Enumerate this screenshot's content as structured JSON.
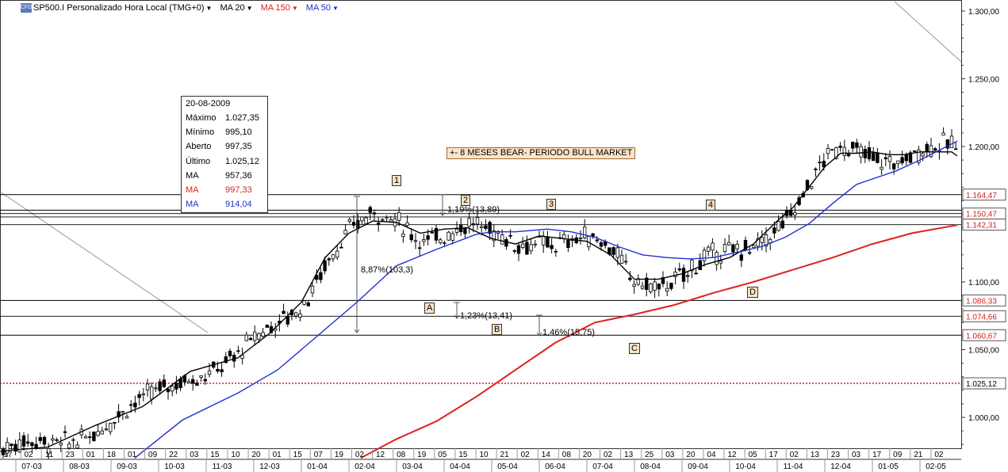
{
  "toolbar": {
    "symbol": "SP500.I Personalizado Hora Local (TMG+0)",
    "ma20": "MA 20",
    "ma150": "MA 150",
    "ma50": "MA 50",
    "logo": "CFD"
  },
  "colors": {
    "ma20": "#000000",
    "ma50": "#1f2fd6",
    "ma150": "#e02020",
    "price_label": "#e02020",
    "banner_bg": "#ffe3c8"
  },
  "info": {
    "date": "20-08-2009",
    "rows": [
      {
        "k": "Máximo",
        "v": "1.027,35",
        "color": "#000000"
      },
      {
        "k": "Mínimo",
        "v": "995,10",
        "color": "#000000"
      },
      {
        "k": "Aberto",
        "v": "997,35",
        "color": "#000000"
      },
      {
        "k": "Último",
        "v": "1.025,12",
        "color": "#000000"
      },
      {
        "k": "MA",
        "v": "957,36",
        "color": "#000000"
      },
      {
        "k": "MA",
        "v": "997,33",
        "color": "#e02020"
      },
      {
        "k": "MA",
        "v": "914,04",
        "color": "#1f2fd6"
      }
    ]
  },
  "banner": "+- 8 MESES BEAR- PERIODO BULL MARKET",
  "chart_data": {
    "type": "candlestick",
    "y_ticks": [
      "1.300,00",
      "1.250,00",
      "1.200,00",
      "1.150,00",
      "1.100,00",
      "1.050,00",
      "1.000,00"
    ],
    "y_tick_values": [
      1300,
      1250,
      1200,
      1150,
      1100,
      1050,
      1000
    ],
    "ylim": [
      970,
      1310
    ],
    "x_day_ticks": [
      "17",
      "02",
      "11",
      "23",
      "01",
      "18",
      "01",
      "09",
      "22",
      "03",
      "15",
      "10",
      "20",
      "01",
      "15",
      "07",
      "19",
      "02",
      "12",
      "08",
      "19",
      "05",
      "15",
      "10",
      "21",
      "02",
      "14",
      "08",
      "20",
      "02",
      "13",
      "25",
      "03",
      "20",
      "04",
      "12",
      "05",
      "17",
      "02",
      "13",
      "23",
      "03",
      "17",
      "09",
      "21",
      "02"
    ],
    "x_month_ticks": [
      "07-03",
      "08-03",
      "09-03",
      "10-03",
      "11-03",
      "12-03",
      "01-04",
      "02-04",
      "03-04",
      "04-04",
      "05-04",
      "06-04",
      "07-04",
      "08-04",
      "09-04",
      "10-04",
      "11-04",
      "12-04",
      "01-05",
      "02-05"
    ],
    "horizontal_levels": [
      {
        "label": "1.164,47",
        "value": 1164.47
      },
      {
        "label": "1.150,47",
        "value": 1150.47
      },
      {
        "label": "1.142,31",
        "value": 1142.31
      },
      {
        "label": "1.086,33",
        "value": 1086.33
      },
      {
        "label": "1.074,66",
        "value": 1074.66
      },
      {
        "label": "1.060,67",
        "value": 1060.67
      }
    ],
    "last_price": {
      "label": "1.025,12",
      "value": 1025.12
    },
    "wave_labels": [
      "1",
      "2",
      "3",
      "4",
      "A",
      "B",
      "C",
      "D"
    ],
    "annotations": [
      "8,87%(103,3)",
      "1,19%(13,89)",
      "1,23%(13,41)",
      "1,46%(15,75)"
    ],
    "series": [
      {
        "name": "MA 20",
        "points": [
          [
            0,
            975
          ],
          [
            60,
            978
          ],
          [
            120,
            994
          ],
          [
            180,
            1008
          ],
          [
            240,
            1034
          ],
          [
            300,
            1044
          ],
          [
            340,
            1062
          ],
          [
            380,
            1085
          ],
          [
            410,
            1118
          ],
          [
            440,
            1136
          ],
          [
            470,
            1145
          ],
          [
            500,
            1144
          ],
          [
            530,
            1136
          ],
          [
            560,
            1139
          ],
          [
            590,
            1140
          ],
          [
            620,
            1132
          ],
          [
            650,
            1128
          ],
          [
            680,
            1134
          ],
          [
            710,
            1132
          ],
          [
            740,
            1130
          ],
          [
            770,
            1120
          ],
          [
            800,
            1102
          ],
          [
            830,
            1102
          ],
          [
            860,
            1106
          ],
          [
            890,
            1113
          ],
          [
            920,
            1118
          ],
          [
            950,
            1128
          ],
          [
            980,
            1145
          ],
          [
            1000,
            1155
          ],
          [
            1020,
            1170
          ],
          [
            1040,
            1185
          ],
          [
            1060,
            1195
          ],
          [
            1080,
            1195
          ],
          [
            1100,
            1196
          ],
          [
            1120,
            1194
          ],
          [
            1140,
            1194
          ],
          [
            1160,
            1196
          ],
          [
            1180,
            1196
          ],
          [
            1200,
            1196
          ],
          [
            1207,
            1193
          ]
        ]
      },
      {
        "name": "MA 50",
        "points": [
          [
            170,
            970
          ],
          [
            230,
            998
          ],
          [
            300,
            1018
          ],
          [
            350,
            1035
          ],
          [
            400,
            1060
          ],
          [
            450,
            1085
          ],
          [
            500,
            1112
          ],
          [
            550,
            1124
          ],
          [
            600,
            1135
          ],
          [
            620,
            1137
          ],
          [
            650,
            1137
          ],
          [
            690,
            1139
          ],
          [
            720,
            1137
          ],
          [
            750,
            1133
          ],
          [
            780,
            1126
          ],
          [
            810,
            1120
          ],
          [
            840,
            1118
          ],
          [
            870,
            1117
          ],
          [
            900,
            1118
          ],
          [
            930,
            1122
          ],
          [
            960,
            1126
          ],
          [
            990,
            1133
          ],
          [
            1020,
            1143
          ],
          [
            1050,
            1158
          ],
          [
            1080,
            1172
          ],
          [
            1100,
            1176
          ],
          [
            1130,
            1182
          ],
          [
            1160,
            1190
          ],
          [
            1190,
            1199
          ],
          [
            1207,
            1204
          ]
        ]
      },
      {
        "name": "MA 150",
        "points": [
          [
            455,
            970
          ],
          [
            500,
            984
          ],
          [
            550,
            997
          ],
          [
            600,
            1015
          ],
          [
            650,
            1035
          ],
          [
            700,
            1055
          ],
          [
            750,
            1070
          ],
          [
            800,
            1076
          ],
          [
            850,
            1083
          ],
          [
            900,
            1092
          ],
          [
            950,
            1100
          ],
          [
            1000,
            1109
          ],
          [
            1050,
            1118
          ],
          [
            1100,
            1128
          ],
          [
            1150,
            1136
          ],
          [
            1207,
            1142
          ]
        ]
      }
    ]
  }
}
